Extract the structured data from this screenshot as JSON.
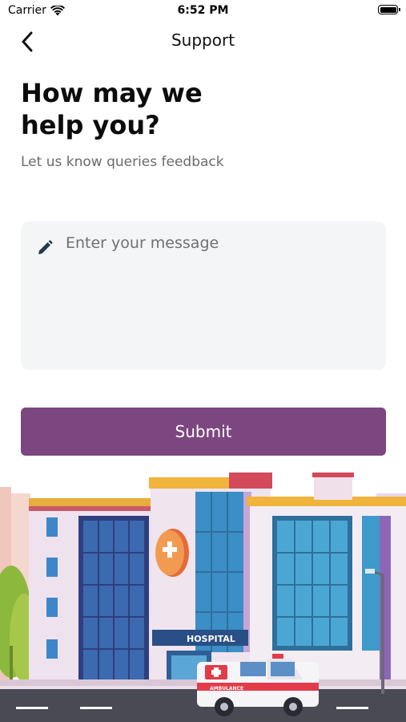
{
  "status_bar": {
    "carrier": "Carrier",
    "time": "6:52 PM"
  },
  "nav": {
    "title": "Support",
    "back_icon": "chevron-left-icon"
  },
  "content": {
    "heading": "How may we help you?",
    "subheading": "Let us know queries feedback"
  },
  "message": {
    "placeholder": "Enter your message",
    "value": "",
    "icon": "pencil-icon"
  },
  "submit": {
    "label": "Submit"
  },
  "illustration": {
    "hospital_sign": "HOSPITAL",
    "ambulance_text": "AMBULANCE"
  },
  "colors": {
    "accent": "#7c4780",
    "input_bg": "#f3f5f7",
    "heading": "#0c0c0c",
    "subtext": "#6b6b6b"
  }
}
